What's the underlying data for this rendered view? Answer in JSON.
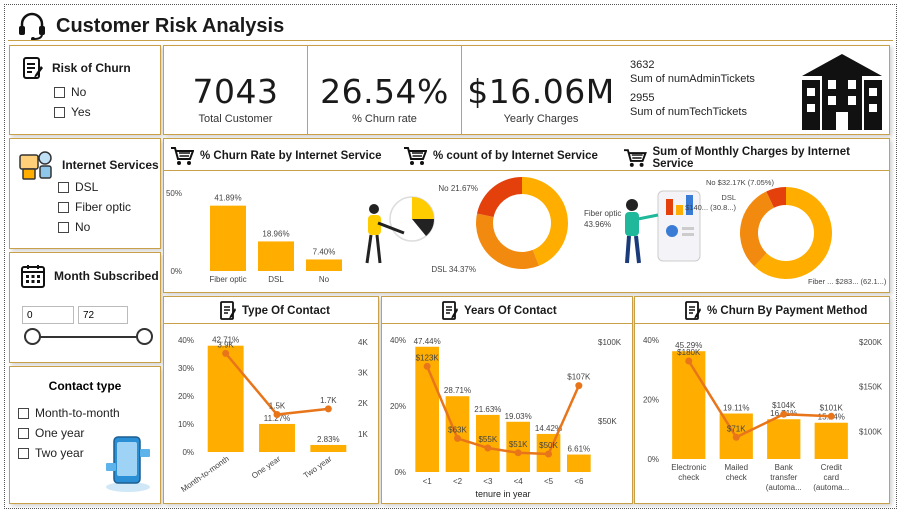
{
  "header": {
    "title": "Customer Risk Analysis"
  },
  "filters": {
    "risk": {
      "title": "Risk of Churn",
      "options": [
        "No",
        "Yes"
      ]
    },
    "internet": {
      "title": "Internet Services",
      "options": [
        "DSL",
        "Fiber optic",
        "No"
      ]
    },
    "months": {
      "title": "Month Subscribed",
      "min": "0",
      "max": "72"
    },
    "contact": {
      "title": "Contact type",
      "options": [
        "Month-to-month",
        "One year",
        "Two year"
      ]
    }
  },
  "kpis": {
    "total": {
      "value": "7043",
      "label": "Total Customer"
    },
    "churn": {
      "value": "26.54%",
      "label": "% Churn rate"
    },
    "charges": {
      "value": "$16.06M",
      "label": "Yearly Charges"
    },
    "admin": {
      "value": "3632",
      "label": "Sum of numAdminTickets"
    },
    "tech": {
      "value": "2955",
      "label": "Sum of numTechTickets"
    }
  },
  "charts": {
    "churn_by_internet": {
      "title": "% Churn  Rate by Internet Service",
      "y_ticks": [
        "50%",
        "0%"
      ],
      "categories": [
        "Fiber optic",
        "DSL",
        "No"
      ],
      "labels": [
        "41.89%",
        "18.96%",
        "7.40%"
      ]
    },
    "count_by_internet": {
      "title": "% count of by Internet Service",
      "slice_labels": [
        "No 21.67%",
        "Fiber optic",
        "43.96%",
        "DSL 34.37%"
      ]
    },
    "monthly_by_internet": {
      "title": "Sum of Monthly Charges by Internet Service",
      "slice_labels": [
        "No $32.17K (7.05%)",
        "DSL",
        "$140... (30.8...)",
        "Fiber ... $283... (62.1...)"
      ]
    },
    "type_of_contact": {
      "title": "Type Of Contact",
      "y_left": [
        "40%",
        "30%",
        "20%",
        "10%",
        "0%"
      ],
      "y_right": [
        "4K",
        "3K",
        "2K",
        "1K"
      ],
      "categories": [
        "Month-to-month",
        "One year",
        "Two year"
      ],
      "bar_labels": [
        "42.71%",
        "11.27%",
        "2.83%"
      ],
      "line_labels": [
        "3.9K",
        "1.5K",
        "1.7K"
      ]
    },
    "years_of_contact": {
      "title": "Years Of Contact",
      "y_left": [
        "40%",
        "20%",
        "0%"
      ],
      "y_right": [
        "$100K",
        "$50K"
      ],
      "categories": [
        "<1",
        "<2",
        "<3",
        "<4",
        "<5",
        "<6"
      ],
      "bar_labels": [
        "47.44%",
        "28.71%",
        "21.63%",
        "19.03%",
        "14.42%",
        "6.61%"
      ],
      "line_labels": [
        "$123K",
        "$63K",
        "$55K",
        "$51K",
        "$50K",
        "$107K"
      ],
      "xlabel": "tenure in year"
    },
    "payment": {
      "title": "% Churn By Payment Method",
      "y_left": [
        "40%",
        "20%",
        "0%"
      ],
      "y_right": [
        "$200K",
        "$150K",
        "$100K"
      ],
      "categories": [
        "Electronic check",
        "Mailed check",
        "Bank transfer (automa...",
        "Credit card (automa..."
      ],
      "bar_labels": [
        "45.29%",
        "19.11%",
        "16.71%",
        "15.24%"
      ],
      "line_labels": [
        "$180K",
        "$71K",
        "$104K",
        "$101K"
      ]
    }
  },
  "chart_data": [
    {
      "type": "bar",
      "title": "% Churn  Rate by Internet Service",
      "categories": [
        "Fiber optic",
        "DSL",
        "No"
      ],
      "values": [
        41.89,
        18.96,
        7.4
      ],
      "ylim": [
        0,
        50
      ]
    },
    {
      "type": "pie",
      "title": "% count of by Internet Service",
      "categories": [
        "Fiber optic",
        "DSL",
        "No"
      ],
      "values": [
        43.96,
        34.37,
        21.67
      ]
    },
    {
      "type": "pie",
      "title": "Sum of Monthly Charges by Internet Service",
      "categories": [
        "Fiber optic",
        "DSL",
        "No"
      ],
      "values": [
        62.1,
        30.8,
        7.05
      ]
    },
    {
      "type": "bar",
      "title": "Type Of Contact",
      "categories": [
        "Month-to-month",
        "One year",
        "Two year"
      ],
      "values": [
        42.71,
        11.27,
        2.83
      ],
      "ylim": [
        0,
        45
      ],
      "line_values": [
        3875,
        1473,
        1695
      ],
      "line_ylim": [
        0,
        4400
      ]
    },
    {
      "type": "bar",
      "title": "Years Of Contact",
      "xlabel": "tenure in year",
      "categories": [
        "<1",
        "<2",
        "<3",
        "<4",
        "<5",
        "<6"
      ],
      "values": [
        47.44,
        28.71,
        21.63,
        19.03,
        14.42,
        6.61
      ],
      "ylim": [
        0,
        50
      ],
      "line_values": [
        123000,
        63000,
        55000,
        51000,
        50000,
        107000
      ],
      "line_ylim": [
        35000,
        145000
      ]
    },
    {
      "type": "bar",
      "title": "% Churn By Payment Method",
      "categories": [
        "Electronic check",
        "Mailed check",
        "Bank transfer (automa...",
        "Credit card (automa..."
      ],
      "values": [
        45.29,
        19.11,
        16.71,
        15.24
      ],
      "ylim": [
        0,
        50
      ],
      "line_values": [
        180000,
        71000,
        104000,
        101000
      ],
      "line_ylim": [
        40000,
        210000
      ]
    }
  ],
  "colors": {
    "bar": "#ffae00",
    "line": "#e8751a",
    "fiber": "#ffae00",
    "dsl": "#f28a10",
    "no": "#e3400c",
    "gold": "#c9a04a"
  }
}
